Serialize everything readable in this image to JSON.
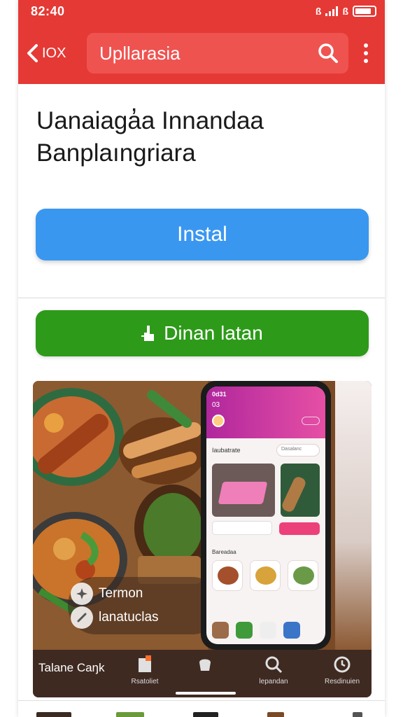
{
  "status_bar": {
    "time": "82:40",
    "bt": "ß",
    "extra": "ß"
  },
  "app_bar": {
    "back_label": "IOX",
    "search_text": "Upllarasia"
  },
  "app_name": "Uanaiaga̓a Innandaa Banplaıngriara",
  "install_label": "Instal",
  "download_label": "Dinan latan",
  "promo": {
    "feature_1": "Termon",
    "feature_2": "lanatuclas",
    "nav_title": "Talane Caŋk",
    "nav_items": [
      "Rsatoliet",
      "",
      "lepandan",
      "Resdinuien"
    ],
    "phone": {
      "time": "0d31",
      "carrier": "03",
      "section": "Iaubatrate",
      "search_placeholder": "Dasalanc",
      "subsection": "Bareadaa"
    }
  },
  "colors": {
    "primary": "#e53935",
    "install": "#3a97f0",
    "download": "#2e9a1a"
  }
}
